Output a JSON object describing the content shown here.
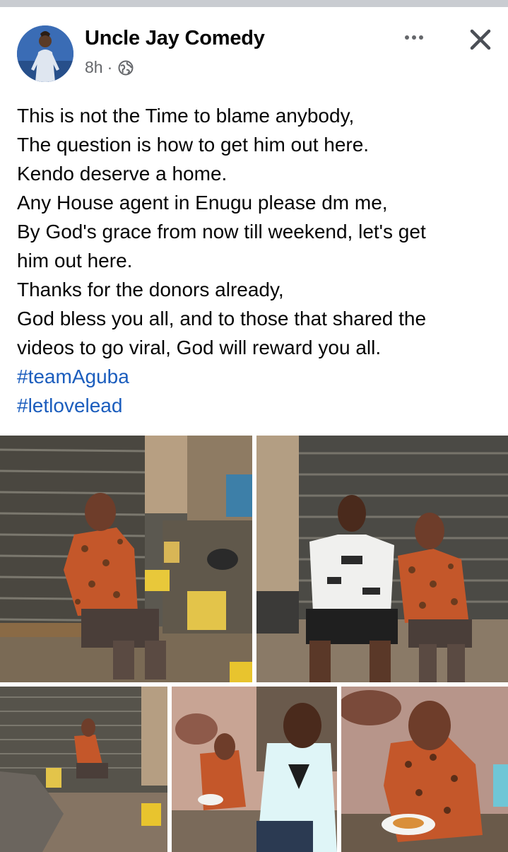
{
  "post": {
    "author": "Uncle Jay Comedy",
    "time": "8h",
    "audience_icon": "globe-icon",
    "lines": [
      "This is not the Time to blame anybody,",
      "The question is how to get him out here.",
      "Kendo deserve a home.",
      "Any House agent in Enugu please dm me,",
      "By God's grace from now till weekend, let's get",
      "him out here.",
      "Thanks for the donors already,",
      "God bless you all, and to those that shared the",
      "videos to go viral, God will reward you all."
    ],
    "hashtags": [
      "#teamAguba",
      "#letlovelead"
    ]
  },
  "icons": {
    "more": "more-options-icon",
    "close": "close-icon"
  },
  "colors": {
    "hashtag": "#1b5dbd",
    "meta": "#65676b",
    "text": "#050505"
  }
}
